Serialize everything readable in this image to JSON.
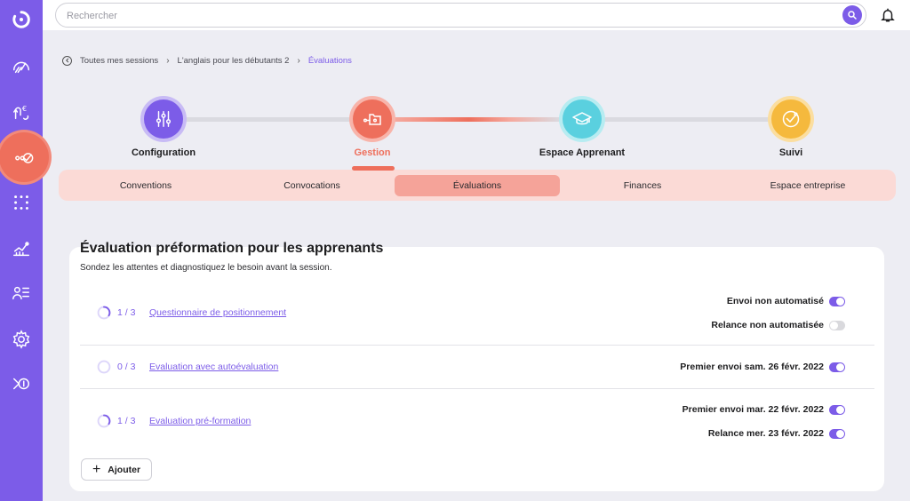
{
  "search": {
    "placeholder": "Rechercher"
  },
  "breadcrumb": {
    "items": [
      "Toutes mes sessions",
      "L'anglais pour les débutants 2"
    ],
    "current": "Évaluations"
  },
  "steps": [
    {
      "label": "Configuration",
      "icon": "sliders-icon",
      "color": "#7c5ce8"
    },
    {
      "label": "Gestion",
      "icon": "folder-network-icon",
      "color": "#ee6f5c"
    },
    {
      "label": "Espace Apprenant",
      "icon": "graduation-cap-icon",
      "color": "#5ad0df"
    },
    {
      "label": "Suivi",
      "icon": "check-badge-icon",
      "color": "#f5b93d"
    }
  ],
  "subtabs": [
    "Conventions",
    "Convocations",
    "Évaluations",
    "Finances",
    "Espace entreprise"
  ],
  "active_subtab": "Évaluations",
  "section": {
    "title": "Évaluation préformation pour les apprenants",
    "subtitle": "Sondez les attentes et diagnostiquez le besoin avant la session."
  },
  "evaluations": [
    {
      "count": "1 / 3",
      "name": "Questionnaire de positionnement",
      "progress": 0.33,
      "options": [
        {
          "label": "Envoi non automatisé",
          "on": true
        },
        {
          "label": "Relance non automatisée",
          "on": false
        }
      ]
    },
    {
      "count": "0 / 3",
      "name": "Evaluation avec autoévaluation",
      "progress": 0,
      "options": [
        {
          "label": "Premier envoi sam. 26 févr. 2022",
          "on": true
        }
      ]
    },
    {
      "count": "1 / 3",
      "name": "Evaluation pré-formation",
      "progress": 0.33,
      "options": [
        {
          "label": "Premier envoi mar. 22 févr. 2022",
          "on": true
        },
        {
          "label": "Relance mer. 23 févr. 2022",
          "on": true
        }
      ]
    }
  ],
  "add_button": "Ajouter",
  "colors": {
    "accent": "#7c5ce8",
    "coral": "#ee6f5c",
    "sidebar": "#7c5ce8"
  }
}
